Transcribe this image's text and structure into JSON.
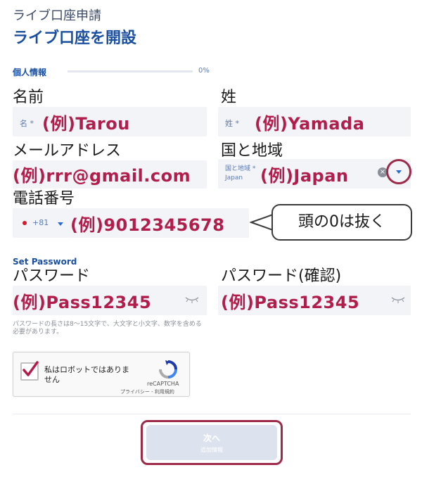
{
  "header": {
    "breadcrumb": "ライブ口座申請",
    "title": "ライブ口座を開設"
  },
  "progress": {
    "section": "個人情報",
    "value_text": "0%",
    "value": 0
  },
  "first_name": {
    "annotation": "名前",
    "placeholder": "名 *",
    "example": "(例)Tarou"
  },
  "last_name": {
    "annotation": "姓",
    "placeholder": "姓 *",
    "example": "(例)Yamada"
  },
  "email": {
    "annotation": "メールアドレス",
    "example": "(例)rrr@gmail.com"
  },
  "country": {
    "annotation": "国と地域",
    "placeholder": "国と地域 *",
    "value": "Japan",
    "example": "(例)Japan",
    "clear_glyph": "×"
  },
  "phone": {
    "annotation": "電話番号",
    "country_code": "+81",
    "example": "(例)9012345678",
    "callout": "頭の0は抜く"
  },
  "password": {
    "section": "Set Password",
    "annotation": "パスワード",
    "example": "(例)Pass12345",
    "hint": "パスワードの長さは8～15文字で、大文字と小文字、数字を含める必要があります。"
  },
  "password_confirm": {
    "annotation": "パスワード(確認)",
    "example": "(例)Pass12345"
  },
  "recaptcha": {
    "label": "私はロボットではありません",
    "brand": "reCAPTCHA",
    "links": "プライバシー - 利用規約"
  },
  "next_button": {
    "label": "次へ",
    "sublabel": "追加情報"
  },
  "colors": {
    "accent": "#1b4fa0",
    "example_text": "#b21e4b",
    "highlight_ring": "#9e2a4a"
  }
}
